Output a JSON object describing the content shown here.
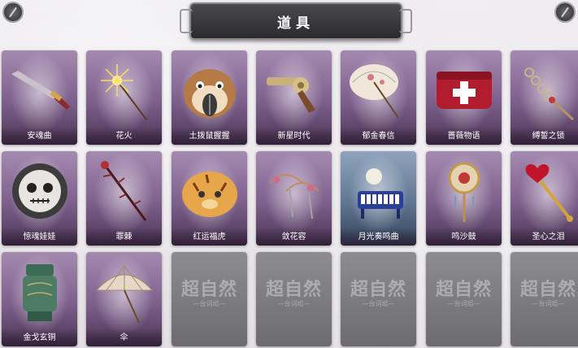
{
  "header": {
    "title": "道具"
  },
  "items": [
    {
      "label": "安魂曲",
      "icon": "dagger-icon",
      "empty": false
    },
    {
      "label": "花火",
      "icon": "sparkler-icon",
      "empty": false
    },
    {
      "label": "土拨鼠握握",
      "icon": "hamster-icon",
      "empty": false
    },
    {
      "label": "新星时代",
      "icon": "revolver-icon",
      "empty": false
    },
    {
      "label": "郁金春信",
      "icon": "parasol-icon",
      "empty": false
    },
    {
      "label": "蔷薇物语",
      "icon": "medkit-icon",
      "empty": false
    },
    {
      "label": "缚誓之锁",
      "icon": "chain-key-icon",
      "empty": false
    },
    {
      "label": "惊魂娃娃",
      "icon": "skull-doll-icon",
      "empty": false
    },
    {
      "label": "罪棘",
      "icon": "thorn-staff-icon",
      "empty": false
    },
    {
      "label": "红运福虎",
      "icon": "tiger-icon",
      "empty": false
    },
    {
      "label": "敛花容",
      "icon": "flower-blades-icon",
      "empty": false
    },
    {
      "label": "月光奏鸣曲",
      "icon": "piano-icon",
      "empty": false,
      "tone": "blue"
    },
    {
      "label": "鸣沙鼓",
      "icon": "drum-icon",
      "empty": false
    },
    {
      "label": "圣心之泪",
      "icon": "heart-scepter-icon",
      "empty": false
    },
    {
      "label": "金戈玄铜",
      "icon": "bronze-vessel-icon",
      "empty": false
    },
    {
      "label": "伞",
      "icon": "umbrella-icon",
      "empty": false
    },
    {
      "label": "",
      "icon": "empty-slot-icon",
      "empty": true,
      "watermark": "超自然",
      "watermark_sub": "—台词组—"
    },
    {
      "label": "",
      "icon": "empty-slot-icon",
      "empty": true,
      "watermark": "超自然",
      "watermark_sub": "—台词组—"
    },
    {
      "label": "",
      "icon": "empty-slot-icon",
      "empty": true,
      "watermark": "超自然",
      "watermark_sub": "—台词组—"
    },
    {
      "label": "",
      "icon": "empty-slot-icon",
      "empty": true,
      "watermark": "超自然",
      "watermark_sub": "—台词组—"
    },
    {
      "label": "",
      "icon": "empty-slot-icon",
      "empty": true,
      "watermark": "超自然",
      "watermark_sub": "—台词组—"
    }
  ],
  "colors": {
    "card_purple": "#7d5f8c",
    "card_blue": "#5f7591",
    "empty_gray": "#7c7b80",
    "title_plate": "#2b2b2f"
  }
}
